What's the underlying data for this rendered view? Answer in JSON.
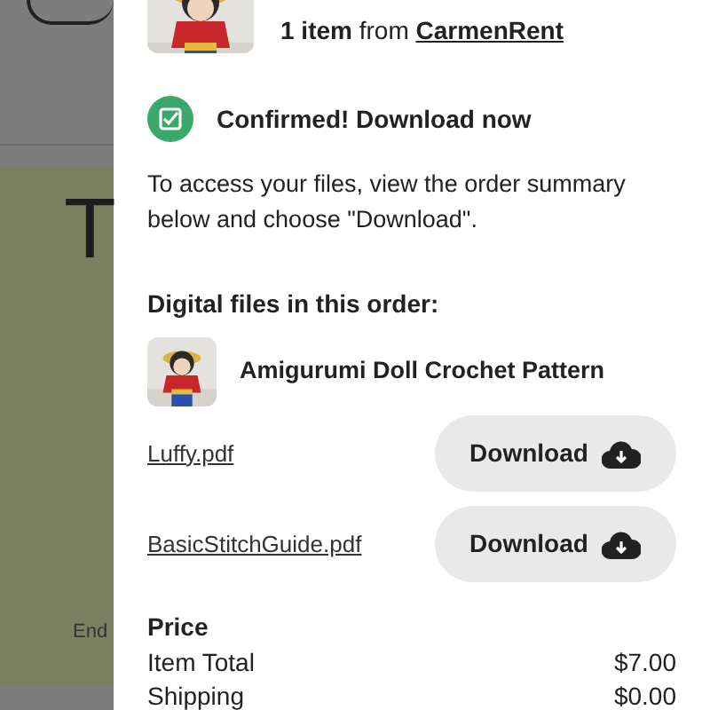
{
  "background": {
    "heading": "T",
    "footer_text": "End"
  },
  "order": {
    "item_count": "1 item",
    "from": "from",
    "shop": "CarmenRent"
  },
  "confirmation": {
    "title": "Confirmed! Download now",
    "text": "To access your files, view the order summary below and choose \"Download\"."
  },
  "files_section": {
    "title": "Digital files in this order:",
    "product": "Amigurumi Doll Crochet Pattern",
    "files": [
      {
        "name": "Luffy.pdf",
        "button": "Download"
      },
      {
        "name": "BasicStitchGuide.pdf",
        "button": "Download"
      }
    ]
  },
  "price": {
    "title": "Price",
    "rows": [
      {
        "label": "Item Total",
        "value": "$7.00"
      },
      {
        "label": "Shipping",
        "value": "$0.00"
      }
    ]
  }
}
